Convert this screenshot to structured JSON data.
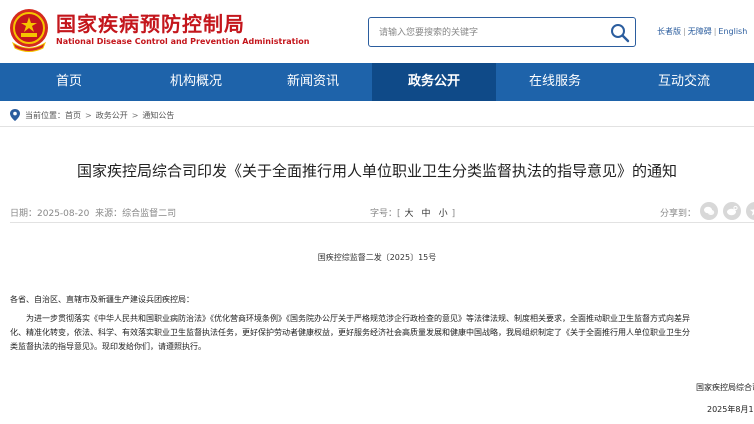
{
  "header": {
    "logo_cn": "国家疾病预防控制局",
    "logo_en": "National Disease Control and Prevention Administration",
    "search_placeholder": "请输入您要搜索的关键字",
    "links": [
      "长者版",
      "无障碍",
      "English"
    ],
    "brand_color": "#c4161c"
  },
  "nav": {
    "items": [
      "首页",
      "机构概况",
      "新闻资讯",
      "政务公开",
      "在线服务",
      "互动交流"
    ],
    "active_index": 3,
    "bg_color": "#1e63aa",
    "active_color": "#0f4a88"
  },
  "breadcrumb": {
    "label": "当前位置：",
    "items": [
      "首页",
      "政务公开",
      "通知公告"
    ],
    "separator": ">"
  },
  "article": {
    "title": "国家疾控局综合司印发《关于全面推行用人单位职业卫生分类监督执法的指导意见》的通知",
    "date_label": "日期：",
    "date": "2025-08-20",
    "source_label": "来源：",
    "source": "综合监督二司",
    "fontsize_label": "字号：",
    "fontsizes": [
      "大",
      "中",
      "小"
    ],
    "share_label": "分享到：",
    "share_icons": [
      "wechat-icon",
      "weibo-icon",
      "qzone-icon"
    ],
    "doc_number": "国疾控综监督二发〔2025〕15号",
    "addressee": "各省、自治区、直辖市及新疆生产建设兵团疾控局：",
    "paragraphs": [
      "为进一步贯彻落实《中华人民共和国职业病防治法》《优化营商环境条例》《国务院办公厅关于严格规范涉企行政检查的意见》等法律法规、制度相关要求，全面推动职业卫生监督方式向差异",
      "化、精准化转变，依法、科学、有效落实职业卫生监督执法任务，更好保护劳动者健康权益，更好服务经济社会高质量发展和健康中国战略，我局组织制定了《关于全面推行用人单位职业卫生分",
      "类监督执法的指导意见》。现印发给你们，请遵照执行。"
    ],
    "signature": "国家疾控局综合司",
    "sign_date": "2025年8月1"
  }
}
